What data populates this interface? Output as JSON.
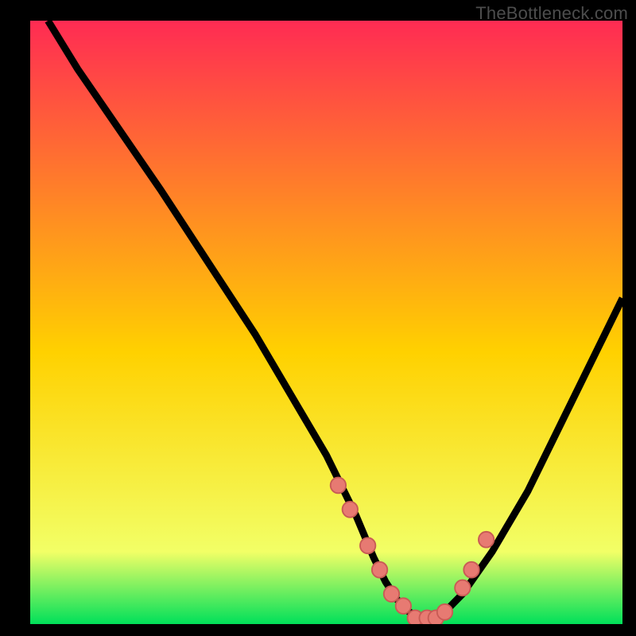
{
  "watermark": "TheBottleneck.com",
  "colors": {
    "gradient_top": "#ff2b53",
    "gradient_mid": "#ffd100",
    "gradient_low": "#f2ff66",
    "gradient_bottom": "#00e05a",
    "curve": "#000000",
    "dot_fill": "#e77a72",
    "dot_stroke": "#c85b55",
    "frame": "#000000"
  },
  "chart_data": {
    "type": "line",
    "title": "",
    "xlabel": "",
    "ylabel": "",
    "xlim": [
      0,
      100
    ],
    "ylim": [
      0,
      100
    ],
    "series": [
      {
        "name": "bottleneck-curve",
        "x": [
          3,
          8,
          15,
          22,
          30,
          38,
          44,
          50,
          55,
          58,
          60,
          62,
          64,
          66,
          68,
          70,
          73,
          78,
          84,
          90,
          96,
          100
        ],
        "values": [
          100,
          92,
          82,
          72,
          60,
          48,
          38,
          28,
          18,
          11,
          7,
          4,
          2,
          1,
          1,
          2,
          5,
          12,
          22,
          34,
          46,
          54
        ]
      }
    ],
    "markers": {
      "name": "highlight-dots",
      "x": [
        52,
        54,
        57,
        59,
        61,
        63,
        65,
        67,
        68.5,
        70,
        73,
        74.5,
        77
      ],
      "values": [
        23,
        19,
        13,
        9,
        5,
        3,
        1,
        1,
        1,
        2,
        6,
        9,
        14
      ]
    },
    "grid": false,
    "legend": false
  }
}
